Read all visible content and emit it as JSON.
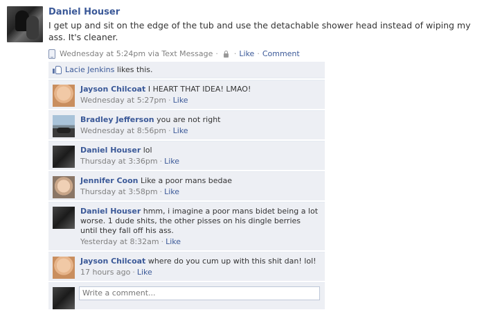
{
  "post": {
    "author": "Daniel Houser",
    "text": "I get up and sit on the edge of the tub and use the detachable shower head instead of wiping my ass. It's cleaner.",
    "timestamp": "Wednesday at 5:24pm via Text Message",
    "like_label": "Like",
    "comment_label": "Comment"
  },
  "likes": {
    "name": "Lacie Jenkins",
    "suffix": "likes this."
  },
  "comments": [
    {
      "author": "Jayson Chilcoat",
      "text": "I HEART THAT IDEA! LMAO!",
      "time": "Wednesday at 5:27pm",
      "like": "Like",
      "avatar": "baby-photo"
    },
    {
      "author": "Bradley Jefferson",
      "text": "you are not right",
      "time": "Wednesday at 8:56pm",
      "like": "Like",
      "avatar": "motorcycle-photo"
    },
    {
      "author": "Daniel Houser",
      "text": "lol",
      "time": "Thursday at 3:36pm",
      "like": "Like",
      "avatar": "daniel-photo"
    },
    {
      "author": "Jennifer Coon",
      "text": "Like a poor mans bedae",
      "time": "Thursday at 3:58pm",
      "like": "Like",
      "avatar": "child-photo"
    },
    {
      "author": "Daniel Houser",
      "text": "hmm, i imagine a poor mans bidet being a lot worse. 1 dude shits, the other pisses on his dingle berries until they fall off his ass.",
      "time": "Yesterday at 8:32am",
      "like": "Like",
      "avatar": "daniel-photo"
    },
    {
      "author": "Jayson Chilcoat",
      "text": "where do you cum up with this shit dan! lol!",
      "time": "17 hours ago",
      "like": "Like",
      "avatar": "baby-photo"
    }
  ],
  "composer": {
    "placeholder": "Write a comment..."
  }
}
